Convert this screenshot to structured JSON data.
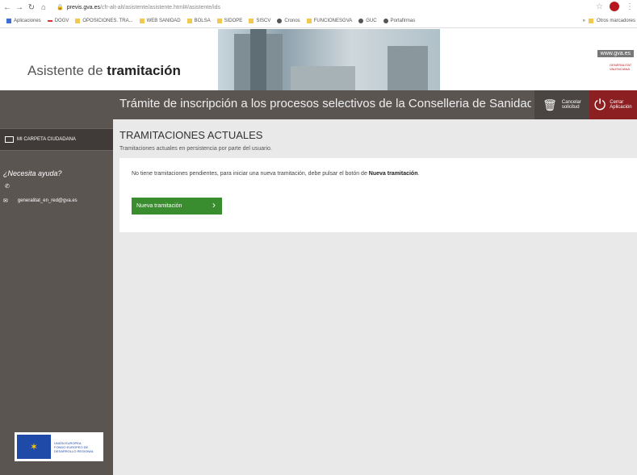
{
  "browser": {
    "url_host": "previs.gva.es",
    "url_path": "/cfr-alt-alt/asistente/asistente.html#/asistente/ids",
    "bookmarks": [
      "Aplicaciones",
      "DOGV",
      "OPOSICIONES. TRA...",
      "WEB SANIDAD",
      "BOLSA",
      "SIDOPE",
      "SISCV",
      "Cronos",
      "FUNCIONESGVA",
      "GUC",
      "Portafirmas"
    ],
    "bookmark_other": "Otros marcadores"
  },
  "banner": {
    "title_light": "Asistente de ",
    "title_bold": "tramitación",
    "www": "www.gva.es",
    "logo_line1": "GENERALITAT",
    "logo_line2": "VALENCIANA"
  },
  "header": {
    "title": "Trámite de inscripción a los procesos selectivos de la Conselleria de Sanidad Universal y S",
    "cancel_line1": "Cancelar",
    "cancel_line2": "solicitud",
    "close_line1": "Cerrar",
    "close_line2": "Aplicación"
  },
  "sidebar": {
    "carpeta": "MI CARPETA CIUDADANA",
    "help_title": "¿Necesita ayuda?",
    "email": "generalitat_en_red@gva.es",
    "eu_line1": "UNIÓN EUROPEA",
    "eu_line2": "FONDO EUROPEO DE",
    "eu_line3": "DESARROLLO REGIONAL"
  },
  "main": {
    "title": "TRAMITACIONES ACTUALES",
    "subtitle": "Tramitaciones actuales en persistencia por parte del usuario.",
    "message_prefix": "No tiene tramitaciones pendientes, para iniciar una nueva tramitación, debe pulsar el botón de ",
    "message_bold": "Nueva tramitación",
    "message_suffix": ".",
    "new_button": "Nueva tramitación"
  },
  "colors": {
    "sidebar_bg": "#5b5552",
    "close_bg": "#8b1f22",
    "new_button_bg": "#3a8d2e",
    "content_bg": "#e9e9e9"
  }
}
